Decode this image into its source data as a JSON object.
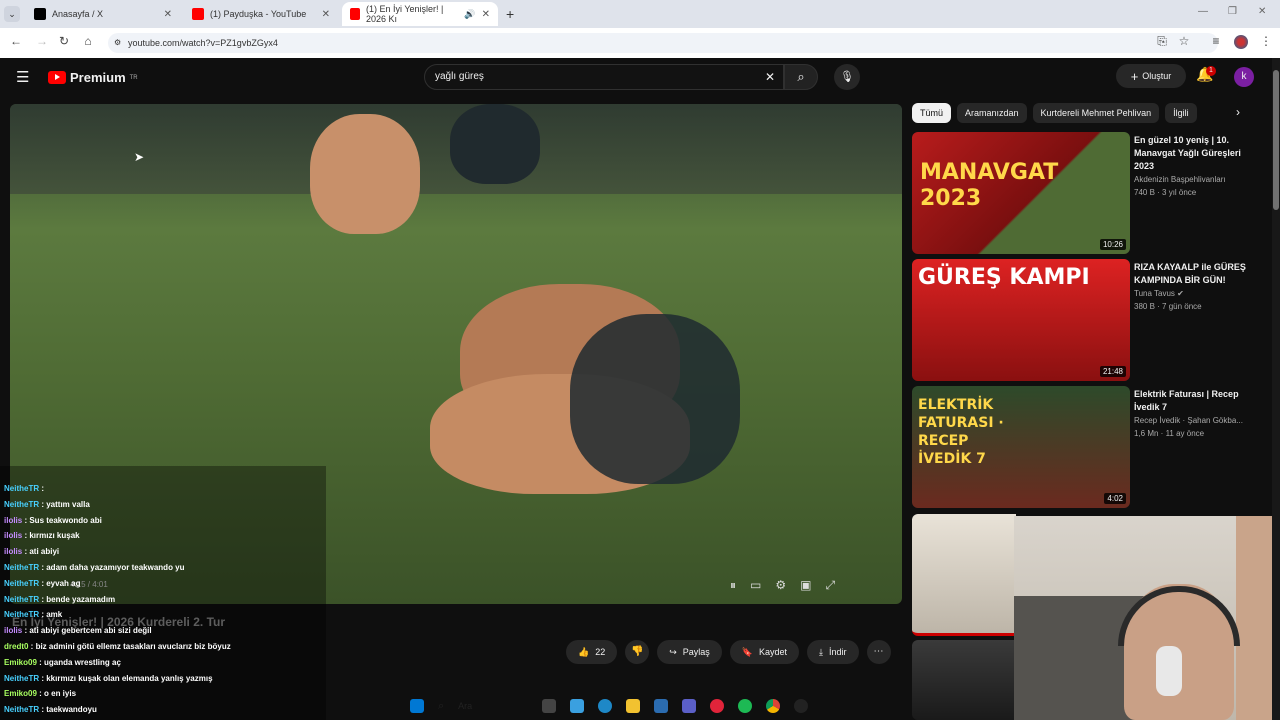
{
  "browser": {
    "tabs": [
      {
        "title": "Anasayfa / X",
        "icon": "x-logo-icon"
      },
      {
        "title": "(1) Payduşka - YouTube",
        "icon": "youtube-icon"
      },
      {
        "title": "(1) En İyi Yenişler! | 2026 Kı",
        "icon": "youtube-icon"
      }
    ],
    "url": "youtube.com/watch?v=PZ1gvbZGyx4"
  },
  "youtube": {
    "logo_text": "Premium",
    "logo_sup": "TR",
    "search_value": "yağlı güreş",
    "create_label": "Oluştur",
    "notification_count": "1",
    "avatar_letter": "k"
  },
  "video": {
    "timecode": "4:15 / 4:01",
    "title": "En İyi Yenişler! | 2026 Kurdereli 2. Tur",
    "likes": "22",
    "share_label": "Paylaş",
    "save_label": "Kaydet",
    "download_label": "İndir"
  },
  "chat": [
    {
      "nick": "NeitheTR",
      "msg": " : ",
      "style": "nick"
    },
    {
      "nick": "NeitheTR",
      "msg": " : yattım valla",
      "style": "nick"
    },
    {
      "nick": "ilolis",
      "msg": " : Sus teakwondo abi",
      "style": "nick3"
    },
    {
      "nick": "ilolis",
      "msg": " : kırmızı kuşak",
      "style": "nick3"
    },
    {
      "nick": "ilolis",
      "msg": " : ati abiyi",
      "style": "nick3"
    },
    {
      "nick": "NeitheTR",
      "msg": " : adam daha yazamıyor teakwando yu",
      "style": "nick"
    },
    {
      "nick": "NeitheTR",
      "msg": " : eyvah ag",
      "style": "nick"
    },
    {
      "nick": "NeitheTR",
      "msg": " : bende yazamadım",
      "style": "nick"
    },
    {
      "nick": "NeitheTR",
      "msg": " : amk",
      "style": "nick"
    },
    {
      "nick": "ilolis",
      "msg": " : ati abiyi gebertcem abi sizi değil",
      "style": "nick3"
    },
    {
      "nick": "dredt0",
      "msg": " : biz admini götü ellemz tasakları avuclarız biz böyuz",
      "style": "nick2"
    },
    {
      "nick": "Emiko09",
      "msg": " : uganda wrestling aç",
      "style": "nick2"
    },
    {
      "nick": "NeitheTR",
      "msg": " : kkırmızı kuşak olan elemanda yanlış yazmış",
      "style": "nick"
    },
    {
      "nick": "Emiko09",
      "msg": " : o en iyis",
      "style": "nick2"
    },
    {
      "nick": "NeitheTR",
      "msg": " : taekwandoyu",
      "style": "nick"
    }
  ],
  "chips": [
    "Tümü",
    "Aramanızdan",
    "Kurtdereli Mehmet Pehlivan",
    "İlgili"
  ],
  "recommendations": [
    {
      "title": "En güzel 10 yeniş | 10. Manavgat Yağlı Güreşleri 2023",
      "channel": "Akdenizin Başpehlivanları",
      "meta": "740 B · 3 yıl önce",
      "duration": "10:26",
      "thumb_text": "MANAVGAT 2023",
      "verified": false
    },
    {
      "title": "RIZA KAYAALP ile GÜREŞ KAMPINDA BİR GÜN!",
      "channel": "Tuna Tavus",
      "meta": "380 B · 7 gün önce",
      "duration": "21:48",
      "thumb_text": "GÜREŞ KAMPI",
      "verified": true
    },
    {
      "title": "Elektrik Faturası | Recep İvedik 7",
      "channel": "Recep İvedik · Şahan Gökba...",
      "meta": "1,6 Mn · 11 ay önce",
      "duration": "4:02",
      "thumb_text": "ELEKTRİK FATURASI · RECEP İVEDİK 7",
      "verified": true
    }
  ],
  "taskbar": {
    "search_label": "Ara"
  },
  "colors": {
    "youtube_red": "#ff0000",
    "bg": "#0f0f0f",
    "chip_bg": "#272727"
  }
}
